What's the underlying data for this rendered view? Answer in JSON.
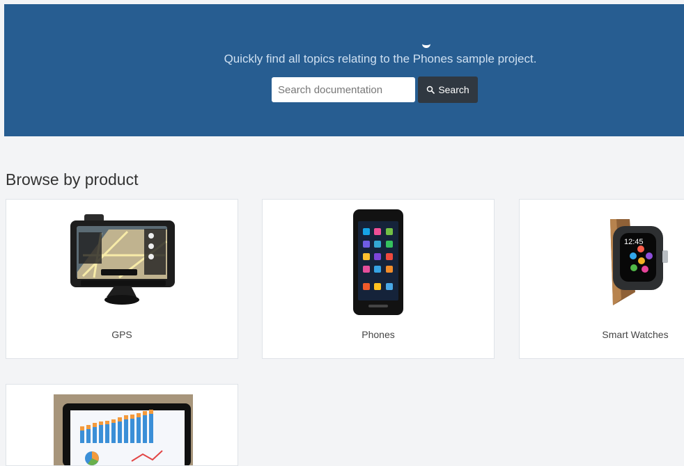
{
  "hero": {
    "subtitle": "Quickly find all topics relating to the Phones sample project.",
    "search": {
      "placeholder": "Search documentation",
      "button_label": "Search"
    }
  },
  "products": {
    "section_title": "Browse by product",
    "items": [
      {
        "label": "GPS",
        "icon": "gps-device-image"
      },
      {
        "label": "Phones",
        "icon": "phone-image"
      },
      {
        "label": "Smart Watches",
        "icon": "smart-watch-image"
      },
      {
        "label": "",
        "icon": "tablet-chart-image"
      }
    ]
  },
  "colors": {
    "header": "#275d91",
    "search_button": "#303841",
    "page_background": "#f3f4f6",
    "card_background": "#ffffff"
  }
}
